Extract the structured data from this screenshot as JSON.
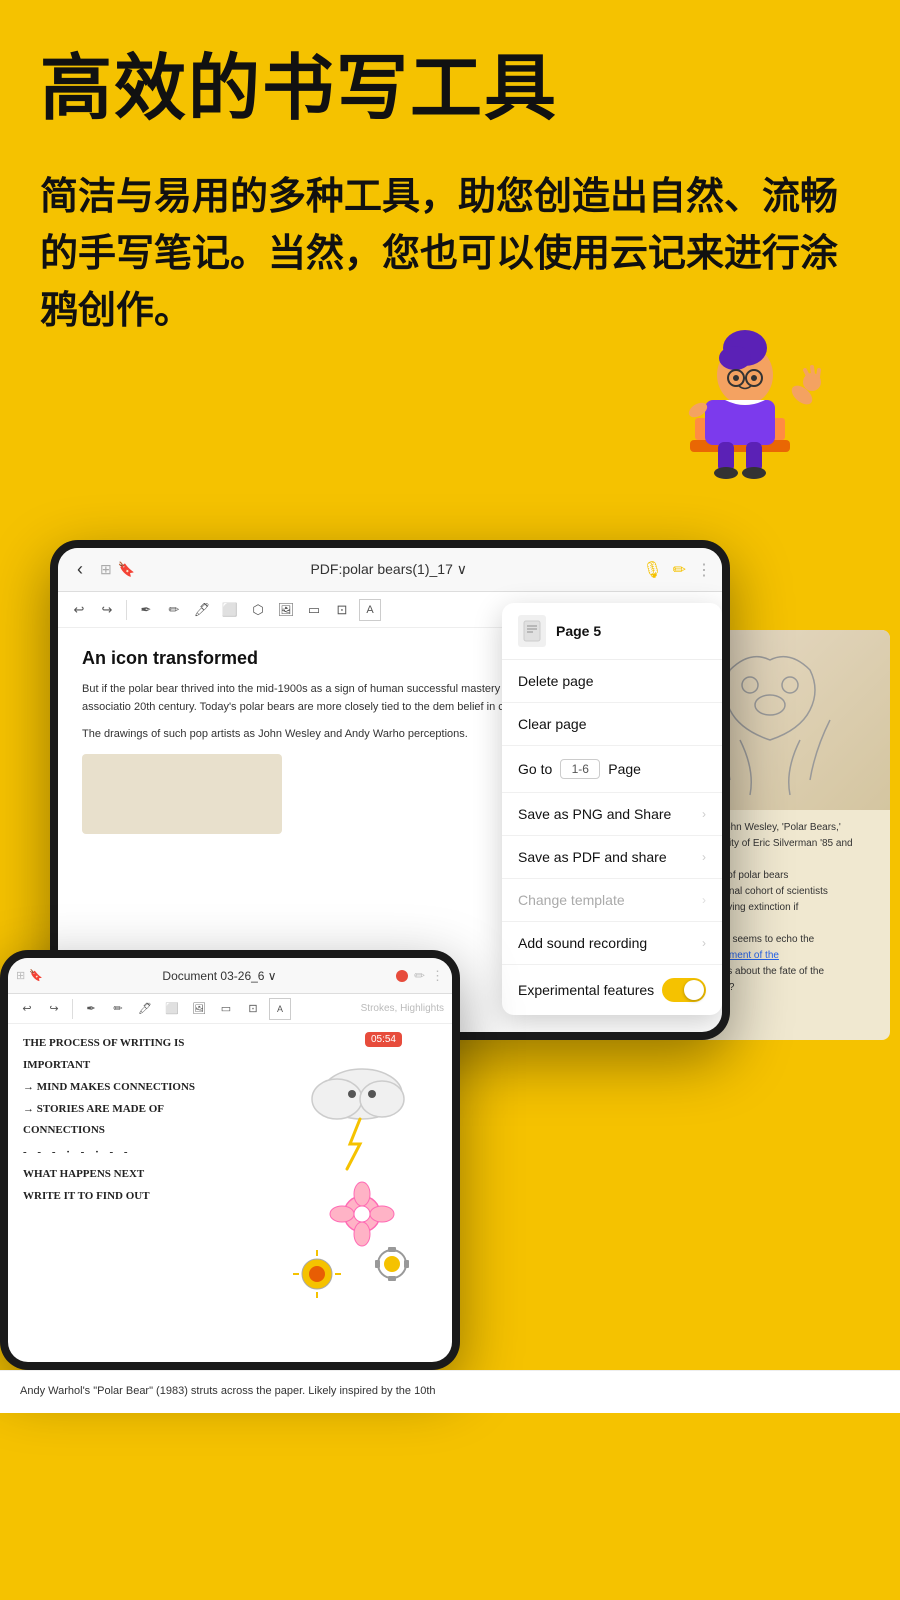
{
  "header": {
    "main_title": "高效的书写工具",
    "subtitle": "简洁与易用的多种工具，助您创造出自然、流畅的手写笔记。当然，您也可以使用云记来进行涂鸦创作。"
  },
  "tablet_main": {
    "toolbar": {
      "title": "PDF:polar bears(1)_17 ∨",
      "back": "‹",
      "more": "⋮"
    },
    "document": {
      "title": "An icon transformed",
      "paragraph1": "But if the polar bear thrived into the mid-1900s as a sign of human successful mastery of antagonistic forces, this symbolic associatio 20th century. Today's polar bears are more closely tied to the dem belief in conquest and domination.",
      "paragraph2": "The drawings of such pop artists as John Wesley and Andy Warho perceptions."
    }
  },
  "dropdown": {
    "page_label": "Page 5",
    "items": [
      {
        "label": "Delete page",
        "has_chevron": false,
        "disabled": false
      },
      {
        "label": "Clear page",
        "has_chevron": false,
        "disabled": false
      },
      {
        "label": "Go to",
        "type": "goto",
        "placeholder": "1-6",
        "page_text": "Page",
        "disabled": false
      },
      {
        "label": "Save as PNG and Share",
        "has_chevron": true,
        "disabled": false
      },
      {
        "label": "Save as PDF and share",
        "has_chevron": true,
        "disabled": false
      },
      {
        "label": "Change template",
        "has_chevron": true,
        "disabled": true
      },
      {
        "label": "Add sound recording",
        "has_chevron": true,
        "disabled": false
      },
      {
        "label": "Experimental features",
        "type": "toggle",
        "disabled": false
      }
    ]
  },
  "tablet_second": {
    "toolbar": {
      "title": "Document 03-26_6 ∨",
      "more": "⋮"
    },
    "timer": "05:54",
    "strokes_label": "Strokes, Highlights",
    "handwriting": {
      "line1": "The Process of Writing Is",
      "line2": "Important",
      "line3": "→ Mind Makes Connections",
      "line4": "→ Stories Are Made of",
      "line5": "   Connections",
      "line6": "- - - · - · - -",
      "line7": "What Happens Next",
      "line8": "Write It to Find Out"
    }
  },
  "bottom_content": {
    "text1": "rtwined bodies of polar bears",
    "text2": "ar, an international cohort of scientists",
    "text3": "chance of surviving extinction if",
    "text4": "reat white bear\" seems to echo the",
    "text5_link": "the U.S. Department of the",
    "text5_pre": "",
    "text6": "raises questions about the fate of the",
    "text7": "n fact a tragedy?",
    "bottom_bar_text": "Andy Warhol's \"Polar Bear\" (1983) struts across the paper. Likely inspired by the 10th"
  },
  "colors": {
    "background": "#F5C200",
    "toggle_on": "#F5C200",
    "record_dot": "#e74c3c",
    "link_color": "#2563eb"
  }
}
